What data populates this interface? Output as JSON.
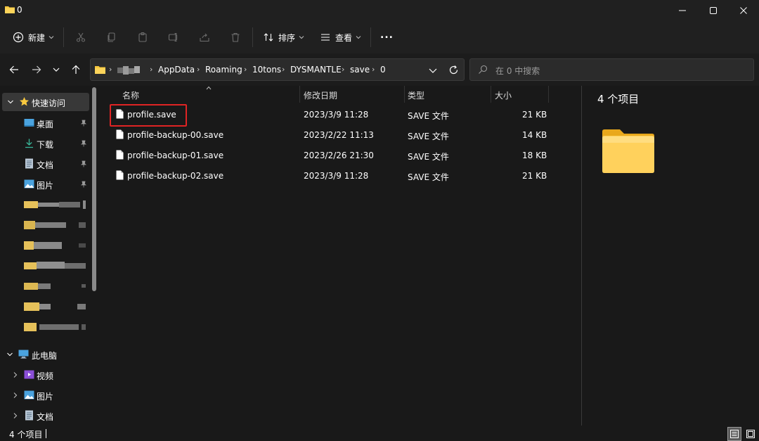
{
  "window": {
    "title": "0"
  },
  "toolbar": {
    "new_label": "新建",
    "sort_label": "排序",
    "view_label": "查看",
    "more_label": "..."
  },
  "address": {
    "crumbs": [
      "AppData",
      "Roaming",
      "10tons",
      "DYSMANTLE",
      "save",
      "0"
    ]
  },
  "search": {
    "placeholder": "在 0 中搜索"
  },
  "sidebar": {
    "quick_access": "快速访问",
    "items": [
      {
        "label": "桌面",
        "icon": "desktop-icon"
      },
      {
        "label": "下载",
        "icon": "download-icon"
      },
      {
        "label": "文档",
        "icon": "document-icon"
      },
      {
        "label": "图片",
        "icon": "picture-icon"
      }
    ],
    "this_pc": "此电脑",
    "pc_items": [
      {
        "label": "视频",
        "icon": "video-icon"
      },
      {
        "label": "图片",
        "icon": "picture-icon"
      },
      {
        "label": "文档",
        "icon": "document-icon"
      }
    ]
  },
  "files": {
    "columns": {
      "name": "名称",
      "modified": "修改日期",
      "type": "类型",
      "size": "大小"
    },
    "rows": [
      {
        "name": "profile.save",
        "modified": "2023/3/9 11:28",
        "type": "SAVE 文件",
        "size": "21 KB"
      },
      {
        "name": "profile-backup-00.save",
        "modified": "2023/2/22 11:13",
        "type": "SAVE 文件",
        "size": "14 KB"
      },
      {
        "name": "profile-backup-01.save",
        "modified": "2023/2/26 21:30",
        "type": "SAVE 文件",
        "size": "18 KB"
      },
      {
        "name": "profile-backup-02.save",
        "modified": "2023/3/9 11:28",
        "type": "SAVE 文件",
        "size": "21 KB"
      }
    ]
  },
  "details": {
    "count": "4 个项目"
  },
  "status": {
    "text": "4 个项目"
  },
  "colors": {
    "background": "#191919",
    "chrome": "#202020",
    "folder": "#f8c93f",
    "highlight": "#e02424",
    "accent": "#4aa3df"
  }
}
